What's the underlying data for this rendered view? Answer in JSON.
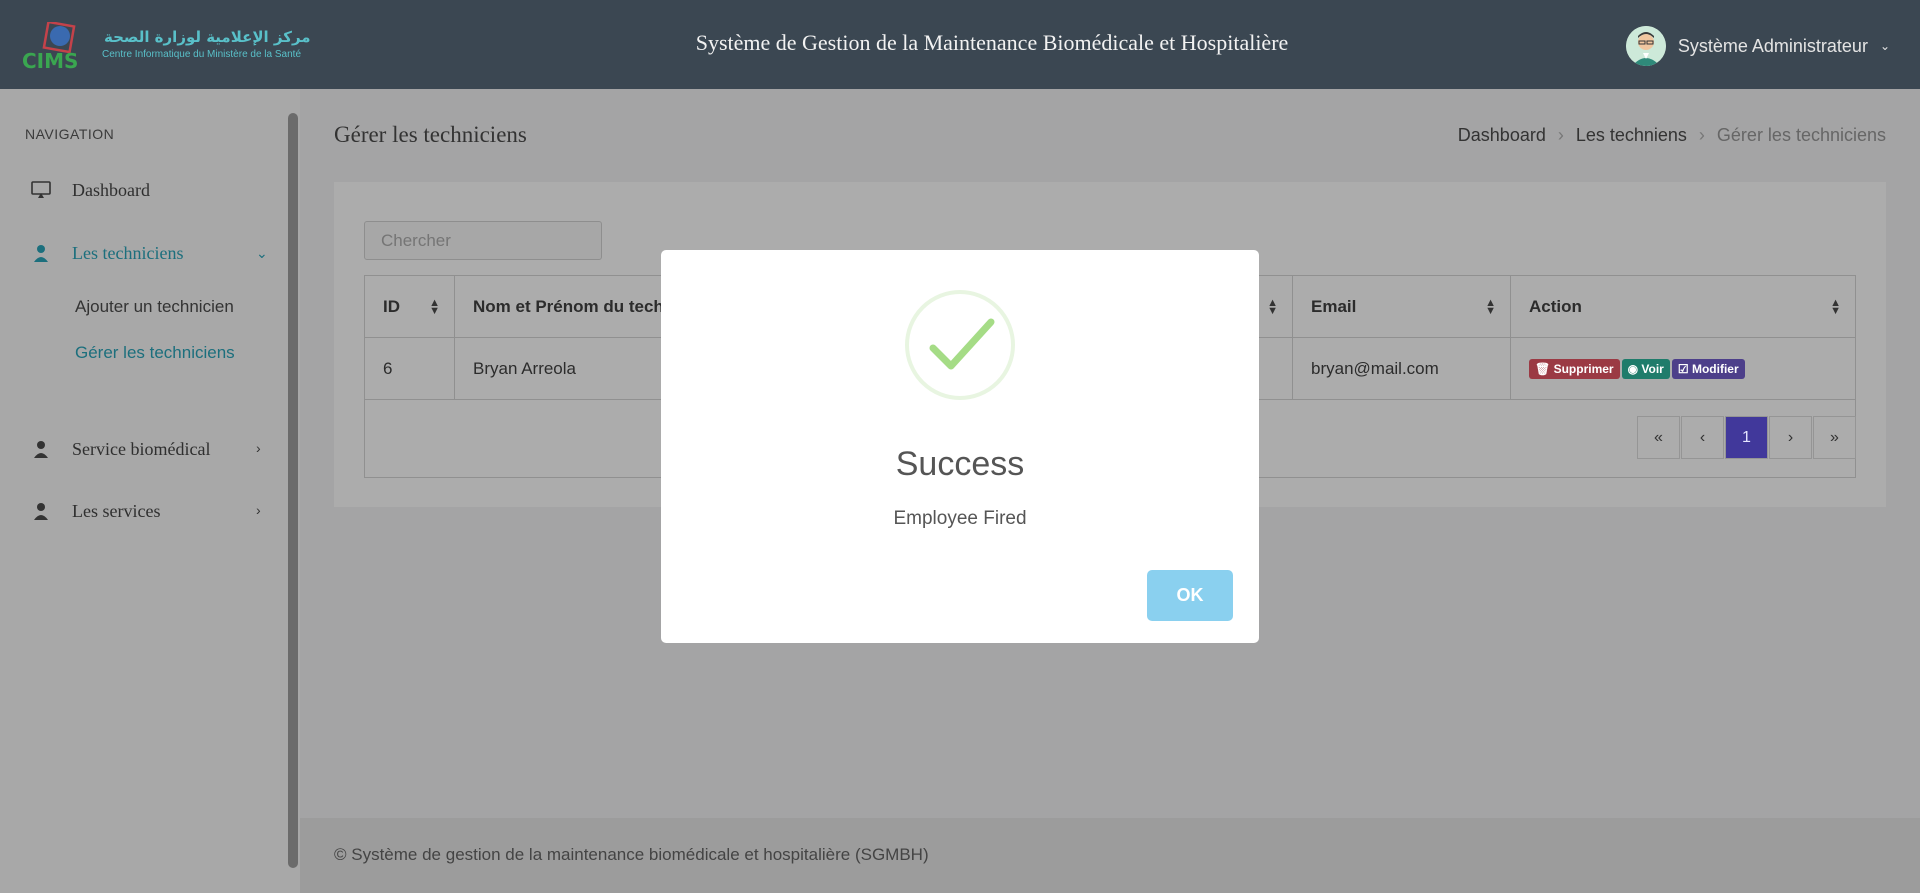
{
  "header": {
    "logo_arabic": "مركز الإعلامية لوزارة الصحة",
    "logo_french": "Centre Informatique du Ministère de la Santé",
    "logo_short": "CIMS",
    "app_title": "Système de Gestion de la Maintenance Biomédicale et Hospitalière",
    "user_name": "Système Administrateur"
  },
  "sidebar": {
    "heading": "NAVIGATION",
    "items": [
      {
        "label": "Dashboard",
        "icon": "monitor-icon"
      },
      {
        "label": "Les techniciens",
        "icon": "user-icon",
        "active": true
      },
      {
        "label": "Service biomédical",
        "icon": "user-icon"
      },
      {
        "label": "Les services",
        "icon": "user-icon"
      }
    ],
    "subitems": [
      {
        "label": "Ajouter un technicien"
      },
      {
        "label": "Gérer les techniciens",
        "active": true
      }
    ]
  },
  "page": {
    "title": "Gérer les techniciens",
    "breadcrumb": [
      "Dashboard",
      "Les techniens",
      "Gérer les techniciens"
    ]
  },
  "search": {
    "placeholder": "Chercher"
  },
  "table": {
    "columns": [
      "ID",
      "Nom et Prénom du tech",
      "Email",
      "Action"
    ],
    "rows": [
      {
        "id": "6",
        "name": "Bryan Arreola",
        "email": "bryan@mail.com"
      }
    ],
    "actions": {
      "delete": "Supprimer",
      "view": "Voir",
      "edit": "Modifier"
    }
  },
  "pagination": {
    "first": "«",
    "prev": "‹",
    "current": "1",
    "next": "›",
    "last": "»"
  },
  "footer": {
    "text": "© Système de gestion de la maintenance biomédicale et hospitalière (SGMBH)"
  },
  "modal": {
    "title": "Success",
    "text": "Employee Fired",
    "ok_label": "OK"
  },
  "colors": {
    "accent": "#41389b",
    "success": "#a5dc86",
    "ok_button": "#8ad0ef",
    "topbar": "#3b4752"
  }
}
